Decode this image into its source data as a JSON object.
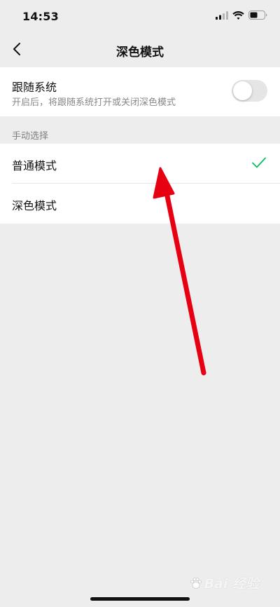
{
  "status_bar": {
    "time": "14:53"
  },
  "nav": {
    "title": "深色模式"
  },
  "follow_system": {
    "title": "跟随系统",
    "description": "开启后，将跟随系统打开或关闭深色模式",
    "enabled": false
  },
  "manual_section": {
    "label": "手动选择",
    "options": [
      {
        "label": "普通模式",
        "selected": true
      },
      {
        "label": "深色模式",
        "selected": false
      }
    ]
  },
  "watermark": {
    "text": "Bai 经验"
  },
  "colors": {
    "background": "#ededed",
    "card": "#ffffff",
    "accent_green": "#07c160",
    "annotation_arrow": "#e60012"
  },
  "icons": {
    "back": "chevron-left-icon",
    "check": "check-icon",
    "signal": "signal-icon",
    "wifi": "wifi-icon",
    "battery": "battery-icon"
  }
}
